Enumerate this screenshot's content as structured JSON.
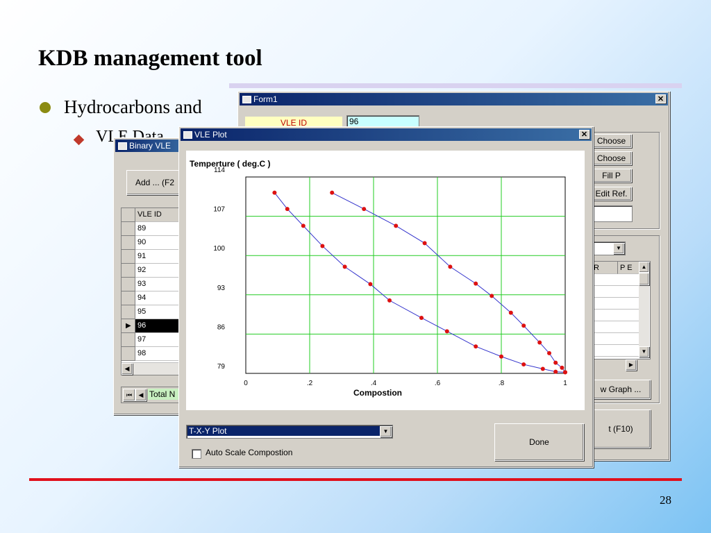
{
  "slide": {
    "title": "KDB management tool",
    "bullet": "Hydrocarbons and",
    "sub_bullet": "VLE Data",
    "page_number": "28"
  },
  "binary_window": {
    "title": "Binary VLE",
    "add_button": "Add ... (F2",
    "column_header": "VLE ID",
    "rows": [
      "89",
      "90",
      "91",
      "92",
      "93",
      "94",
      "95",
      "96",
      "97",
      "98"
    ],
    "selected_row": "96",
    "total_label": "Total N"
  },
  "form1_window": {
    "title": "Form1",
    "vle_id_label": "VLE ID",
    "vle_id_value": "96",
    "buttons": [
      "Choose",
      "Choose",
      "Fill P",
      "Edit Ref."
    ],
    "grid_headers": [
      "R",
      "P E"
    ],
    "view_graph_button": "w Graph ...",
    "exit_button": "t (F10)"
  },
  "plot_window": {
    "title": "VLE Plot",
    "plot_type_select": "T-X-Y Plot",
    "done_button": "Done",
    "auto_scale_label": "Auto Scale Compostion"
  },
  "chart_data": {
    "type": "line",
    "title": "Temperture  ( deg.C )",
    "xlabel": "Compostion",
    "ylabel": "Temperture  ( deg.C )",
    "xlim": [
      0,
      1
    ],
    "ylim": [
      79,
      114
    ],
    "x_tick_labels": [
      "0",
      ".2",
      ".4",
      ".6",
      ".8",
      "1"
    ],
    "x_ticks": [
      0,
      0.2,
      0.4,
      0.6,
      0.8,
      1
    ],
    "y_tick_labels": [
      "114",
      "107",
      "100",
      "93",
      "86",
      "79"
    ],
    "y_ticks": [
      114,
      107,
      100,
      93,
      86,
      79
    ],
    "grid": true,
    "series": [
      {
        "color": "#3333cc",
        "marker_color": "#dd1111",
        "x": [
          0.09,
          0.13,
          0.18,
          0.24,
          0.31,
          0.39,
          0.45,
          0.55,
          0.63,
          0.72,
          0.8,
          0.87,
          0.93,
          0.97,
          1.0
        ],
        "y": [
          111.2,
          108.3,
          105.3,
          101.7,
          98.0,
          94.9,
          92.0,
          88.9,
          86.5,
          83.8,
          82.0,
          80.6,
          79.8,
          79.3,
          79.2
        ]
      },
      {
        "color": "#3333cc",
        "marker_color": "#dd1111",
        "x": [
          0.27,
          0.37,
          0.47,
          0.56,
          0.64,
          0.72,
          0.77,
          0.83,
          0.87,
          0.92,
          0.95,
          0.97,
          0.99,
          1.0
        ],
        "y": [
          111.2,
          108.3,
          105.3,
          102.2,
          98.0,
          95.0,
          92.8,
          89.8,
          87.5,
          84.5,
          82.6,
          80.9,
          80.0,
          79.2
        ]
      }
    ]
  }
}
